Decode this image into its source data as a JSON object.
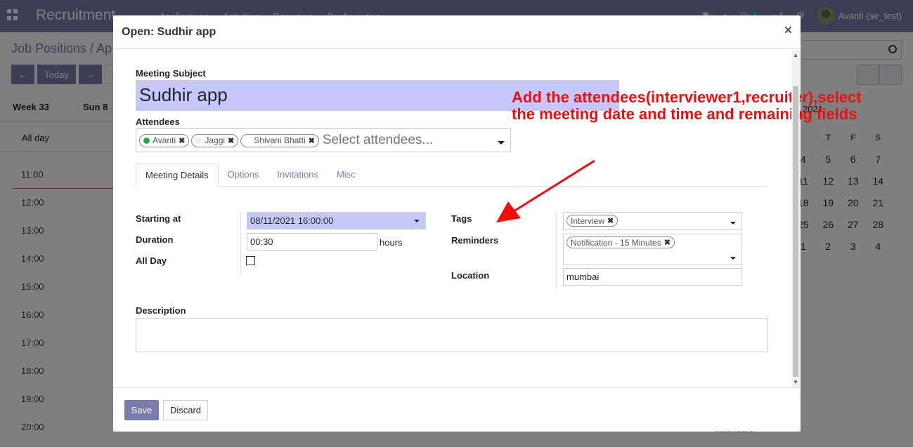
{
  "app": {
    "title": "Recruitment",
    "menu": [
      "Applications",
      "Activities",
      "Reporting",
      "Configuration"
    ],
    "user": "Avanti (se_test)",
    "messages_count": "1",
    "activities_count": "1"
  },
  "breadcrumb": "Job Positions / Ap",
  "calendar": {
    "today_label": "Today",
    "week_label": "Week 33",
    "day_label": "Sun 8",
    "allday_label": "All day",
    "hours": [
      "11:00",
      "12:00",
      "13:00",
      "14:00",
      "15:00",
      "16:00",
      "17:00",
      "18:00",
      "19:00",
      "20:00"
    ],
    "mini_year": "2021",
    "mini_headers": [
      "T",
      "F",
      "S"
    ],
    "mini_rows": [
      [
        "4",
        "5",
        "6",
        "7"
      ],
      [
        "11",
        "12",
        "13",
        "14"
      ],
      [
        "18",
        "19",
        "20",
        "21"
      ],
      [
        "25",
        "26",
        "27",
        "28"
      ],
      [
        "1",
        "2",
        "3",
        "4"
      ]
    ],
    "calendars_label": "calendars"
  },
  "modal": {
    "title": "Open: Sudhir app",
    "close_glyph": "×",
    "subject_label": "Meeting Subject",
    "subject_value": "Sudhir app",
    "attendees_label": "Attendees",
    "attendees": [
      {
        "name": "Avanti",
        "dot_color": "#28a745"
      },
      {
        "name": "Jaggi",
        "dot_color": "#eeeeee"
      },
      {
        "name": "Shivani Bhatti",
        "dot_color": "#ffffff"
      }
    ],
    "attendees_placeholder": "Select attendees...",
    "tabs": [
      "Meeting Details",
      "Options",
      "Invitations",
      "Misc"
    ],
    "starting_label": "Starting at",
    "starting_value": "08/11/2021 16:00:00",
    "duration_label": "Duration",
    "duration_value": "00:30",
    "duration_unit": "hours",
    "allday_label": "All Day",
    "tags_label": "Tags",
    "tags": [
      "Interview"
    ],
    "reminders_label": "Reminders",
    "reminders": [
      "Notification - 15 Minutes"
    ],
    "location_label": "Location",
    "location_value": "mumbai",
    "description_label": "Description",
    "save_label": "Save",
    "discard_label": "Discard"
  },
  "annotation": "Add the attendees(interviewer1,recruiter),select the meeting date and time and remaining fields",
  "colors": {
    "brand": "#7c7bad",
    "highlight_input": "#c7c7fb",
    "annotation": "#f20d0d"
  }
}
